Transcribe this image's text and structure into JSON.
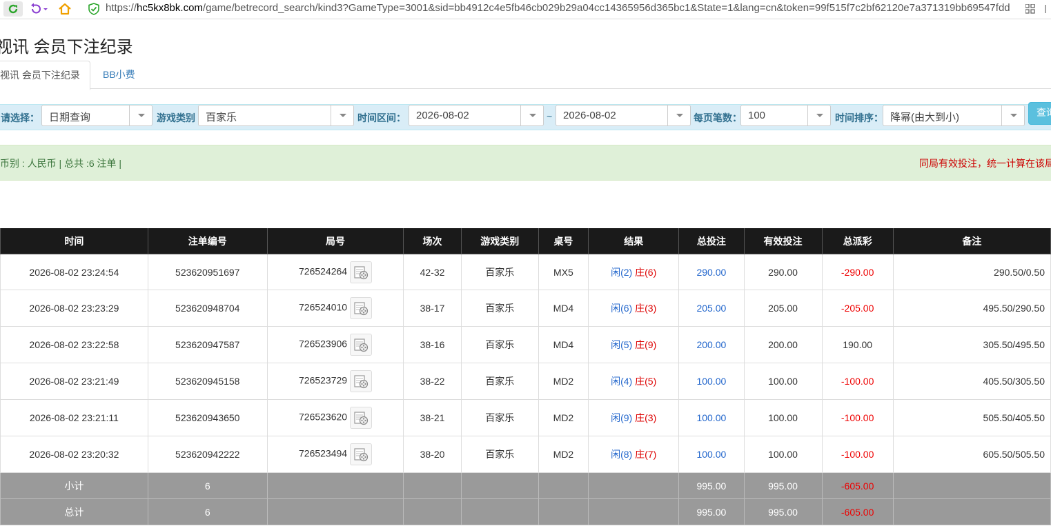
{
  "browser": {
    "url_prefix": "https://",
    "url_host": "hc5kx8bk.com",
    "url_path": "/game/betrecord_search/kind3?GameType=3001&sid=bb4912c4e5fb46cb029b29a04cc14365956d365bc1&State=1&lang=cn&token=99f515f7c2bf62120e7a371319bb69547fdd"
  },
  "page": {
    "title": "视讯 会员下注纪录",
    "tabs": [
      {
        "label": "视讯 会员下注纪录"
      },
      {
        "label": "BB小费"
      }
    ]
  },
  "filters": {
    "select_label": "请选择：",
    "select_value": "日期查询",
    "game_type_label": "游戏类别",
    "game_type_value": "百家乐",
    "time_range_label": "时间区间：",
    "date_from": "2026-08-02",
    "tilde": "~",
    "date_to": "2026-08-02",
    "page_size_label": "每页笔数：",
    "page_size_value": "100",
    "sort_label": "时间排序：",
    "sort_value": "降幂(由大到小)",
    "query_button": "查询"
  },
  "alert": {
    "summary": "币别 : 人民币 | 总共 :6 注单 |",
    "notice": "同局有效投注，统一计算在该局"
  },
  "table": {
    "headers": [
      "时间",
      "注单编号",
      "局号",
      "场次",
      "游戏类别",
      "桌号",
      "结果",
      "总投注",
      "有效投注",
      "总派彩",
      "备注"
    ],
    "rows": [
      {
        "time": "2026-08-02 23:24:54",
        "bet_id": "523620951697",
        "round": "726524264",
        "session": "42-32",
        "game": "百家乐",
        "table": "MX5",
        "xian": "闲(2)",
        "zhuang": "庄(6)",
        "total": "290.00",
        "valid": "290.00",
        "payout": "-290.00",
        "payout_negative": true,
        "remark": "290.50/0.50"
      },
      {
        "time": "2026-08-02 23:23:29",
        "bet_id": "523620948704",
        "round": "726524010",
        "session": "38-17",
        "game": "百家乐",
        "table": "MD4",
        "xian": "闲(6)",
        "zhuang": "庄(3)",
        "total": "205.00",
        "valid": "205.00",
        "payout": "-205.00",
        "payout_negative": true,
        "remark": "495.50/290.50"
      },
      {
        "time": "2026-08-02 23:22:58",
        "bet_id": "523620947587",
        "round": "726523906",
        "session": "38-16",
        "game": "百家乐",
        "table": "MD4",
        "xian": "闲(5)",
        "zhuang": "庄(9)",
        "total": "200.00",
        "valid": "200.00",
        "payout": "190.00",
        "payout_negative": false,
        "remark": "305.50/495.50"
      },
      {
        "time": "2026-08-02 23:21:49",
        "bet_id": "523620945158",
        "round": "726523729",
        "session": "38-22",
        "game": "百家乐",
        "table": "MD2",
        "xian": "闲(4)",
        "zhuang": "庄(5)",
        "total": "100.00",
        "valid": "100.00",
        "payout": "-100.00",
        "payout_negative": true,
        "remark": "405.50/305.50"
      },
      {
        "time": "2026-08-02 23:21:11",
        "bet_id": "523620943650",
        "round": "726523620",
        "session": "38-21",
        "game": "百家乐",
        "table": "MD2",
        "xian": "闲(9)",
        "zhuang": "庄(3)",
        "total": "100.00",
        "valid": "100.00",
        "payout": "-100.00",
        "payout_negative": true,
        "remark": "505.50/405.50"
      },
      {
        "time": "2026-08-02 23:20:32",
        "bet_id": "523620942222",
        "round": "726523494",
        "session": "38-20",
        "game": "百家乐",
        "table": "MD2",
        "xian": "闲(8)",
        "zhuang": "庄(7)",
        "total": "100.00",
        "valid": "100.00",
        "payout": "-100.00",
        "payout_negative": true,
        "remark": "605.50/505.50"
      }
    ],
    "subtotal": {
      "label": "小计",
      "count": "6",
      "total": "995.00",
      "valid": "995.00",
      "payout": "-605.00"
    },
    "grandtotal": {
      "label": "总计",
      "count": "6",
      "total": "995.00",
      "valid": "995.00",
      "payout": "-605.00"
    }
  }
}
